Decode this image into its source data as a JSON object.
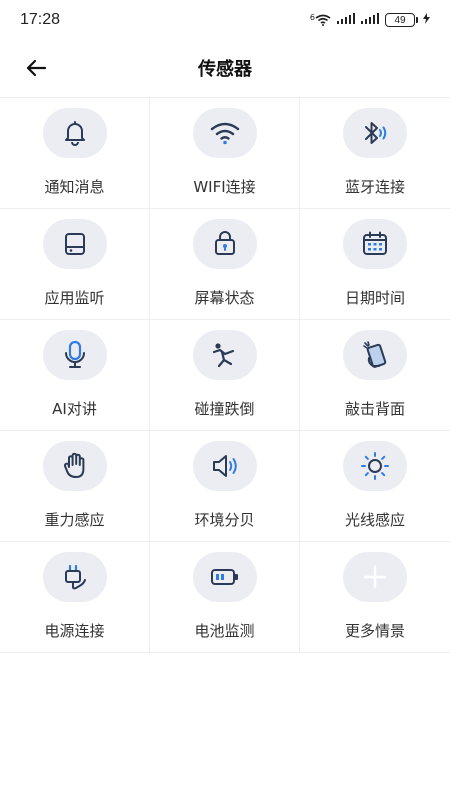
{
  "status_bar": {
    "time": "17:28",
    "network_label": "6",
    "battery": "49"
  },
  "header": {
    "title": "传感器"
  },
  "sensors": [
    {
      "label": "通知消息",
      "icon": "bell-icon"
    },
    {
      "label": "WIFI连接",
      "icon": "wifi-icon"
    },
    {
      "label": "蓝牙连接",
      "icon": "bluetooth-icon"
    },
    {
      "label": "应用监听",
      "icon": "tablet-icon"
    },
    {
      "label": "屏幕状态",
      "icon": "screen-lock-icon"
    },
    {
      "label": "日期时间",
      "icon": "calendar-icon"
    },
    {
      "label": "AI对讲",
      "icon": "microphone-icon"
    },
    {
      "label": "碰撞跌倒",
      "icon": "fall-person-icon"
    },
    {
      "label": "敲击背面",
      "icon": "tap-phone-icon"
    },
    {
      "label": "重力感应",
      "icon": "hand-icon"
    },
    {
      "label": "环境分贝",
      "icon": "speaker-icon"
    },
    {
      "label": "光线感应",
      "icon": "sun-icon"
    },
    {
      "label": "电源连接",
      "icon": "plug-icon"
    },
    {
      "label": "电池监测",
      "icon": "battery-icon"
    },
    {
      "label": "更多情景",
      "icon": "plus-icon"
    }
  ],
  "colors": {
    "icon_dark": "#2b3a55",
    "accent_blue": "#2f7de1",
    "circle_bg": "#ecedf3",
    "plus_color": "#ffffff"
  }
}
